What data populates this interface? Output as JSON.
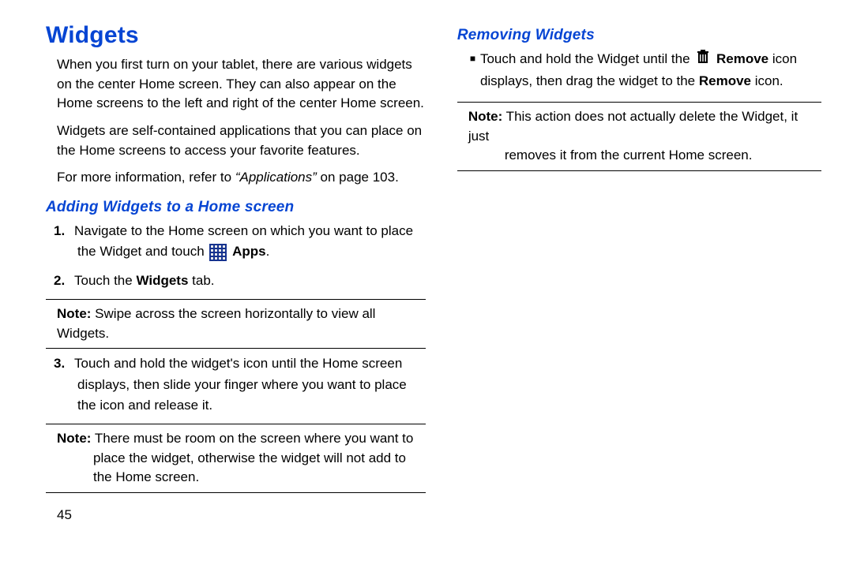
{
  "left": {
    "heading": "Widgets",
    "intro_p1": "When you first turn on your tablet, there are various widgets on the center Home screen. They can also appear on the Home screens to the left and right of the center Home screen.",
    "intro_p2": "Widgets are self-contained applications that you can place on the Home screens to access your favorite features.",
    "ref_prefix": "For more information, refer to ",
    "ref_quoted": "“Applications”",
    "ref_suffix": " on page 103.",
    "sub_adding": "Adding Widgets to a Home screen",
    "step1_num": "1.",
    "step1_a": "Navigate to the Home screen on which you want to place the Widget and touch ",
    "step1_apps": "Apps",
    "step1_dot": ".",
    "step2_num": "2.",
    "step2_a": "Touch the ",
    "step2_widgets": "Widgets",
    "step2_b": " tab.",
    "note1_label": "Note:",
    "note1_text": " Swipe across the screen horizontally to view all Widgets.",
    "step3_num": "3.",
    "step3_text": "Touch and hold the widget's icon until the Home screen displays, then slide your finger where you want to place the icon and release it.",
    "note2_label": "Note:",
    "note2_line1": " There must be room on the screen where you want to",
    "note2_line2": "place the widget, otherwise the widget will not add to the Home screen.",
    "pagenum": "45"
  },
  "right": {
    "sub_removing": "Removing Widgets",
    "bullet_a": "Touch and hold the Widget until the ",
    "bullet_remove1": "Remove",
    "bullet_b": " icon displays, then drag the widget to the ",
    "bullet_remove2": "Remove",
    "bullet_c": " icon.",
    "rnote_label": "Note:",
    "rnote_line1": " This action does not actually delete the Widget, it just",
    "rnote_line2": "removes it from the current Home screen."
  }
}
